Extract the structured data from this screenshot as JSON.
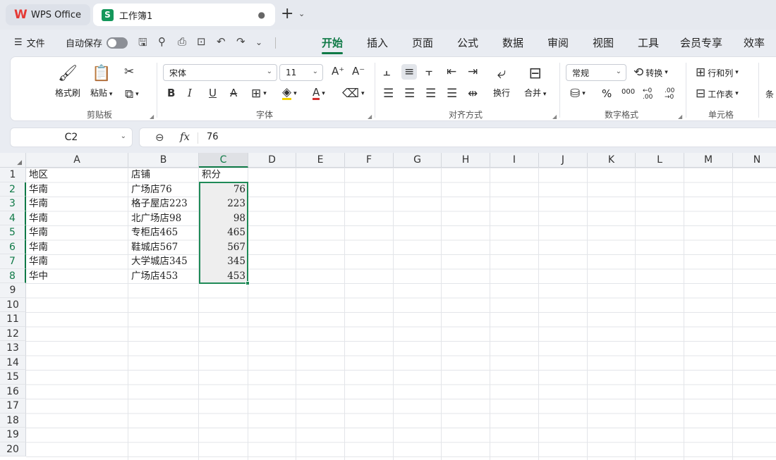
{
  "titlebar": {
    "app_tab": "WPS Office",
    "doc_tab": "工作簿1",
    "doc_tab_dot": "●",
    "new_tab_icon": "+",
    "tab_list_icon": "⌄"
  },
  "menubar": {
    "file_label": "文件",
    "autosave_label": "自动保存",
    "ribbon_tabs": [
      "开始",
      "插入",
      "页面",
      "公式",
      "数据",
      "审阅",
      "视图",
      "工具",
      "会员专享",
      "效率"
    ],
    "active_tab": "开始"
  },
  "ribbon": {
    "clipboard": {
      "format_painter": "格式刷",
      "paste": "粘贴",
      "group_label": "剪贴板"
    },
    "font": {
      "font_name": "宋体",
      "font_size": "11",
      "group_label": "字体"
    },
    "alignment": {
      "wrap": "换行",
      "merge": "合并",
      "group_label": "对齐方式"
    },
    "number": {
      "format": "常规",
      "convert": "转换",
      "percent": "%",
      "thousands": "000",
      "inc_decimal": "←0 .00",
      "dec_decimal": ".00 →0",
      "group_label": "数字格式"
    },
    "cells": {
      "row_col": "行和列",
      "worksheet": "工作表",
      "group_label": "单元格"
    },
    "more_label": "条"
  },
  "formula_bar": {
    "name_box": "C2",
    "fx_label": "fx",
    "value": "76"
  },
  "sheet": {
    "columns": [
      "A",
      "B",
      "C",
      "D",
      "E",
      "F",
      "G",
      "H",
      "I",
      "J",
      "K",
      "L",
      "M",
      "N"
    ],
    "rows": [
      "1",
      "2",
      "3",
      "4",
      "5",
      "6",
      "7",
      "8",
      "9",
      "10",
      "11",
      "12",
      "13",
      "14",
      "15",
      "16",
      "17",
      "18",
      "19",
      "20"
    ],
    "selected_column": "C",
    "data": [
      [
        "地区",
        "店铺",
        "积分"
      ],
      [
        "华南",
        "广场店76",
        "76"
      ],
      [
        "华南",
        "格子屋店223",
        "223"
      ],
      [
        "华南",
        "北广场店98",
        "98"
      ],
      [
        "华南",
        "专柜店465",
        "465"
      ],
      [
        "华南",
        "鞋城店567",
        "567"
      ],
      [
        "华南",
        "大学城店345",
        "345"
      ],
      [
        "华中",
        "广场店453",
        "453"
      ]
    ]
  },
  "colors": {
    "accent": "#107a47",
    "selection_border": "#1f8a57",
    "logo_wps": "#e53935",
    "logo_sheet": "#14975b"
  }
}
